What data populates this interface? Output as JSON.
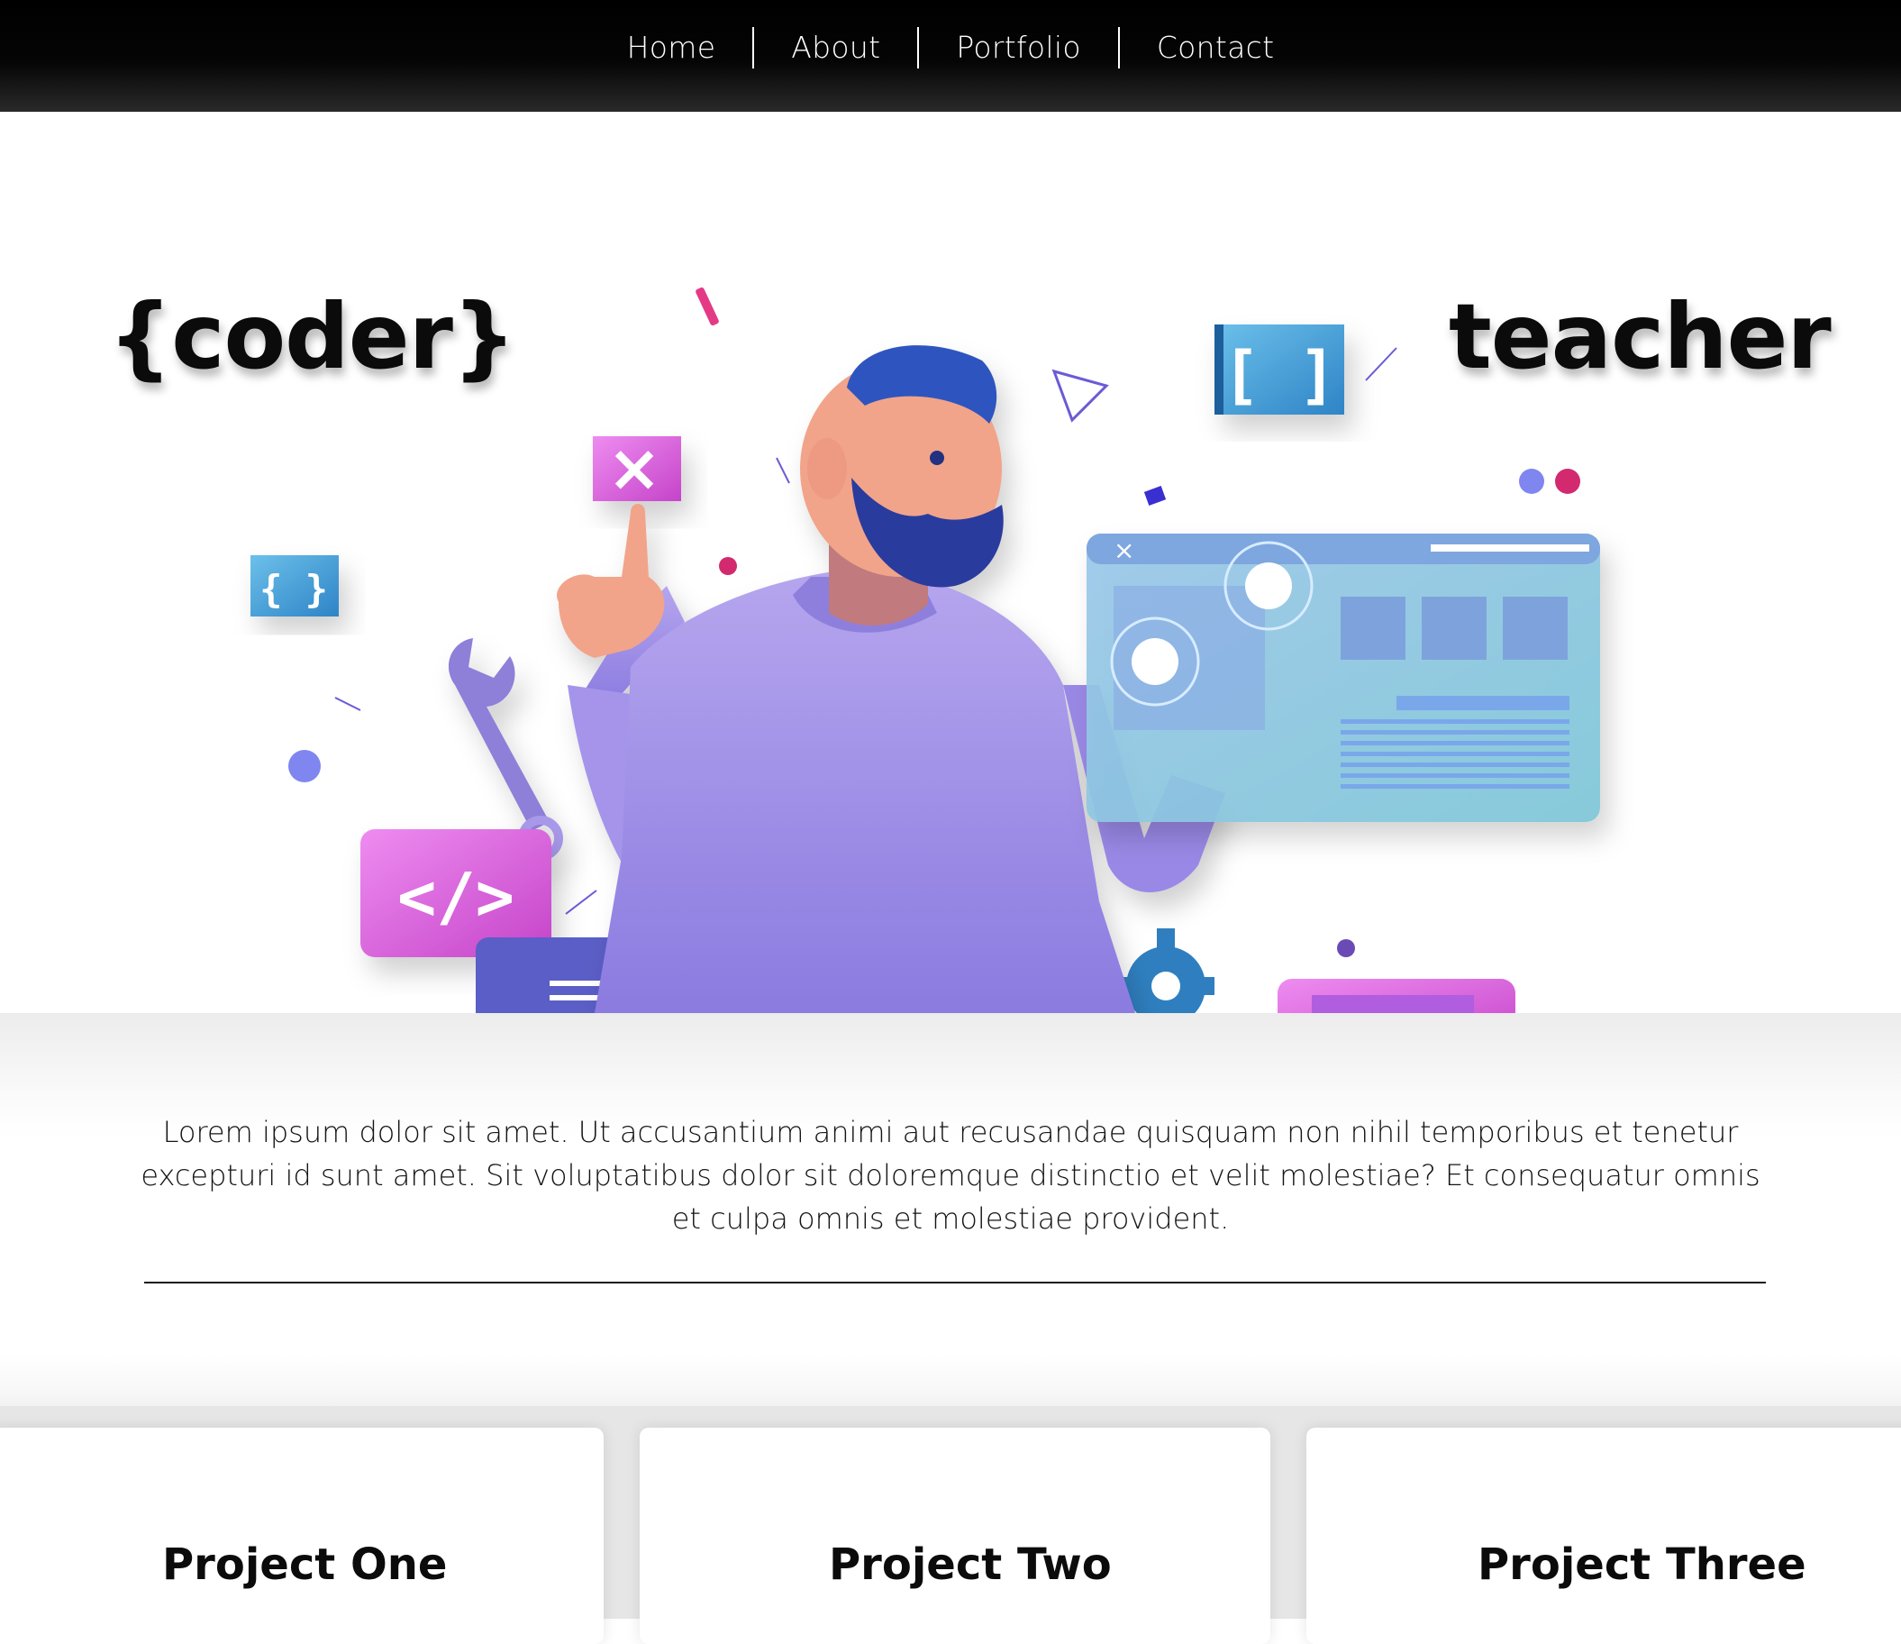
{
  "nav": {
    "items": [
      {
        "label": "Home"
      },
      {
        "label": "About"
      },
      {
        "label": "Portfolio"
      },
      {
        "label": "Contact"
      }
    ]
  },
  "hero": {
    "left_title": "{coder}",
    "right_title": "teacher",
    "illustration_icons": {
      "close": "×",
      "brackets": "[ ]",
      "braces": "{ }",
      "code": "</>"
    }
  },
  "intro": {
    "text": "Lorem ipsum dolor sit amet. Ut accusantium animi aut recusandae quisquam non nihil temporibus et tenetur excepturi id sunt amet. Sit voluptatibus dolor sit doloremque distinctio et velit molestiae? Et consequatur omnis et culpa omnis et molestiae provident."
  },
  "projects": [
    {
      "title": "Project One"
    },
    {
      "title": "Project Two"
    },
    {
      "title": "Project Three"
    }
  ],
  "colors": {
    "nav_bg": "#000000",
    "nav_text": "#ffffff",
    "purple": "#9b8ae6",
    "magenta": "#d54fd8",
    "blue_cube": "#3d8fd1",
    "navy_beard": "#2a3a9e",
    "screen_blue": "#8cc6e3"
  }
}
